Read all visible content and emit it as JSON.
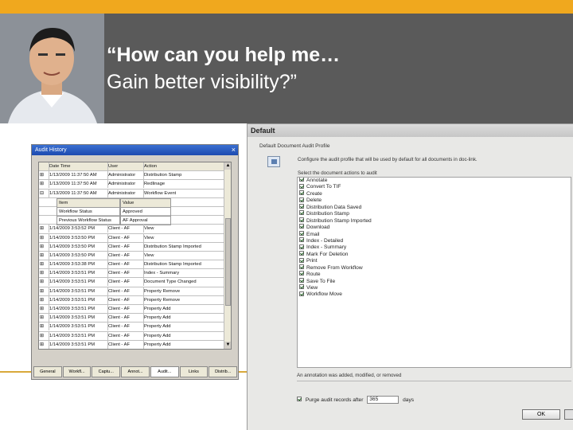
{
  "header": {
    "quote_line1": "“How can you help me…",
    "quote_line2": "Gain better visibility?”"
  },
  "audit_window": {
    "title": "Audit History",
    "close_glyph": "×",
    "columns": [
      "",
      "Date Time",
      "User",
      "Action"
    ],
    "rows_top": [
      [
        "⊞",
        "1/13/2009 11:37:50 AM",
        "Administrator",
        "Distribution Stamp"
      ],
      [
        "⊞",
        "1/13/2009 11:37:50 AM",
        "Administrator",
        "Redlinage"
      ],
      [
        "⊟",
        "1/13/2009 11:37:50 AM",
        "Administrator",
        "Workflow Event"
      ]
    ],
    "sub_header": [
      "Item",
      "Value"
    ],
    "sub_rows": [
      [
        "Workflow Status",
        "Approved"
      ],
      [
        "Previous Workflow Status",
        "AF Approval"
      ]
    ],
    "rows_bottom": [
      [
        "⊞",
        "1/14/2009 3:53:52 PM",
        "Client - AF",
        "View"
      ],
      [
        "⊞",
        "1/14/2009 3:53:50 PM",
        "Client - AF",
        "View"
      ],
      [
        "⊞",
        "1/14/2009 3:53:50 PM",
        "Client - AF",
        "Distribution Stamp Imported"
      ],
      [
        "⊞",
        "1/14/2009 3:53:50 PM",
        "Client - AF",
        "View"
      ],
      [
        "⊞",
        "1/14/2009 3:53:38 PM",
        "Client - AF",
        "Distribution Stamp Imported"
      ],
      [
        "⊞",
        "1/14/2009 3:53:51 PM",
        "Client - AF",
        "Index - Summary"
      ],
      [
        "⊞",
        "1/14/2009 3:53:51 PM",
        "Client - AF",
        "Document Type Changed"
      ],
      [
        "⊞",
        "1/14/2009 3:53:51 PM",
        "Client - AF",
        "Property Remove"
      ],
      [
        "⊞",
        "1/14/2009 3:53:51 PM",
        "Client - AF",
        "Property Remove"
      ],
      [
        "⊞",
        "1/14/2009 3:53:51 PM",
        "Client - AF",
        "Property Add"
      ],
      [
        "⊞",
        "1/14/2009 3:53:51 PM",
        "Client - AF",
        "Property Add"
      ],
      [
        "⊞",
        "1/14/2009 3:53:51 PM",
        "Client - AF",
        "Property Add"
      ],
      [
        "⊞",
        "1/14/2009 3:53:51 PM",
        "Client - AF",
        "Property Add"
      ],
      [
        "⊞",
        "1/14/2009 3:53:51 PM",
        "Client - AF",
        "Property Add"
      ]
    ],
    "tabs": [
      "General",
      "Workfl...",
      "Captu...",
      "Annot...",
      "Audit...",
      "Links",
      "Distrib..."
    ]
  },
  "default_dialog": {
    "title": "Default",
    "section_label": "Default Document Audit Profile",
    "description": "Configure the audit profile that will be used by default for all documents in doc-link.",
    "select_prompt": "Select the document actions to audit",
    "actions": [
      "Annotate",
      "Convert To TIF",
      "Create",
      "Delete",
      "Distribution Data Saved",
      "Distribution Stamp",
      "Distribution Stamp Imported",
      "Download",
      "Email",
      "Index - Detailed",
      "Index - Summary",
      "Mark For Deletion",
      "Print",
      "Remove From Workflow",
      "Route",
      "Save To File",
      "View",
      "Workflow Move"
    ],
    "note": "An annotation was added, modified, or removed",
    "purge_label": "Purge audit records after",
    "purge_days": "365",
    "purge_unit": "days",
    "ok_label": "OK"
  }
}
